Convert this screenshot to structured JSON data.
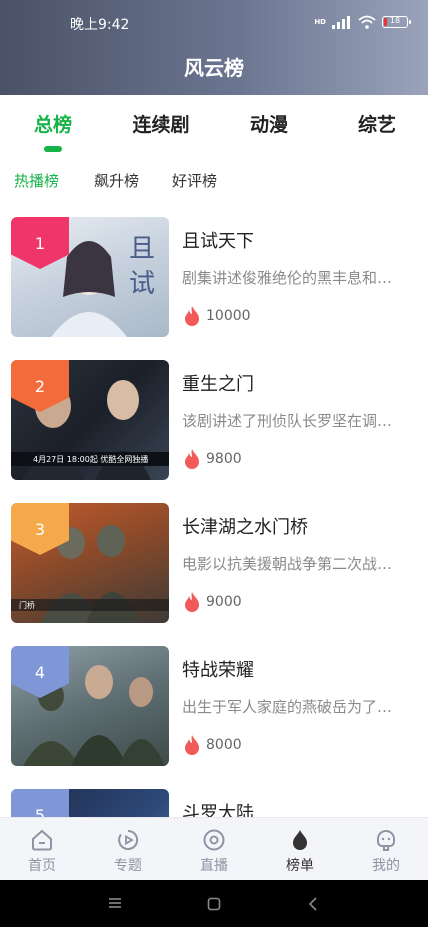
{
  "status": {
    "time": "晚上9:42",
    "battery": "18",
    "network": "HD"
  },
  "header": {
    "title": "风云榜"
  },
  "main_tabs": [
    {
      "label": "总榜",
      "active": true
    },
    {
      "label": "连续剧",
      "active": false
    },
    {
      "label": "动漫",
      "active": false
    },
    {
      "label": "综艺",
      "active": false
    }
  ],
  "sub_tabs": [
    {
      "label": "热播榜",
      "active": true
    },
    {
      "label": "飙升榜",
      "active": false
    },
    {
      "label": "好评榜",
      "active": false
    }
  ],
  "items": [
    {
      "rank": "1",
      "title": "且试天下",
      "desc": "剧集讲述俊雅绝伦的黑丰息和…",
      "heat": "10000",
      "rank_color": "#f0356b"
    },
    {
      "rank": "2",
      "title": "重生之门",
      "desc": "该剧讲述了刑侦队长罗坚在调…",
      "heat": "9800",
      "rank_color": "#f26b3a"
    },
    {
      "rank": "3",
      "title": "长津湖之水门桥",
      "desc": "电影以抗美援朝战争第二次战…",
      "heat": "9000",
      "rank_color": "#f5a94a"
    },
    {
      "rank": "4",
      "title": "特战荣耀",
      "desc": "出生于军人家庭的燕破岳为了…",
      "heat": "8000",
      "rank_color": "#7f97d6"
    },
    {
      "rank": "5",
      "title": "斗罗大陆",
      "desc": "",
      "heat": "",
      "rank_color": "#7f97d6"
    }
  ],
  "bottom_nav": [
    {
      "label": "首页",
      "icon": "home-icon",
      "active": false
    },
    {
      "label": "专题",
      "icon": "play-icon",
      "active": false
    },
    {
      "label": "直播",
      "icon": "live-icon",
      "active": false
    },
    {
      "label": "榜单",
      "icon": "ranking-icon",
      "active": true
    },
    {
      "label": "我的",
      "icon": "profile-icon",
      "active": false
    }
  ],
  "colors": {
    "accent": "#16b348",
    "heat": "#f25a5a"
  }
}
